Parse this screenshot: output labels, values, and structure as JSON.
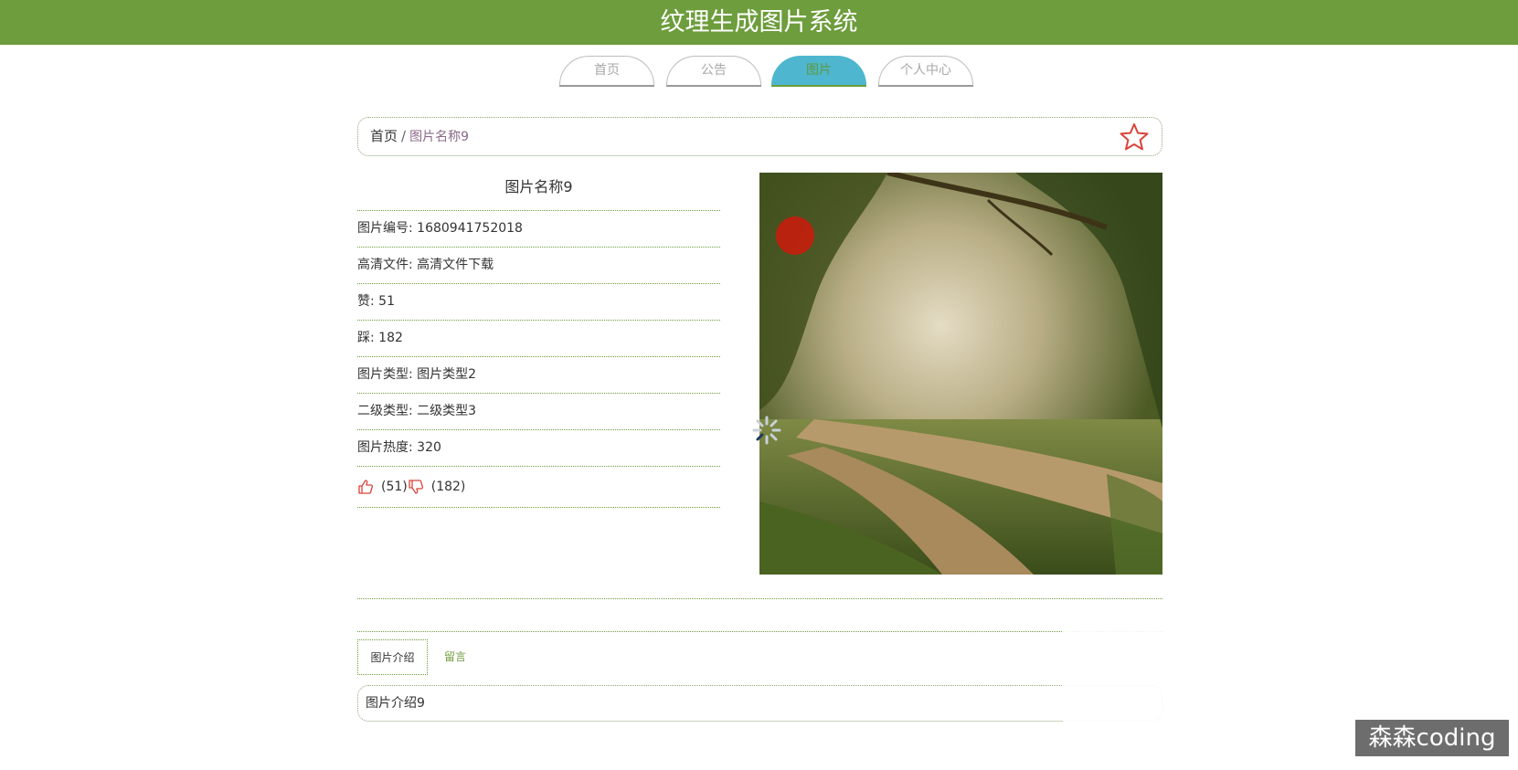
{
  "header": {
    "title": "纹理生成图片系统"
  },
  "nav": {
    "tabs": [
      "首页",
      "公告",
      "图片",
      "个人中心"
    ],
    "active": "图片"
  },
  "breadcrumb": {
    "home": "首页",
    "separator": "/",
    "current": "图片名称9"
  },
  "detail": {
    "title": "图片名称9",
    "rows": [
      {
        "label": "图片编号:",
        "value": "1680941752018"
      },
      {
        "label": "高清文件:",
        "value": "高清文件下载"
      },
      {
        "label": "赞:",
        "value": "51"
      },
      {
        "label": "踩:",
        "value": "182"
      },
      {
        "label": "图片类型:",
        "value": "图片类型2"
      },
      {
        "label": "二级类型:",
        "value": "二级类型3"
      },
      {
        "label": "图片热度:",
        "value": "320"
      }
    ],
    "like_count": "(51)",
    "dislike_count": "(182)"
  },
  "tabs": {
    "intro": "图片介绍",
    "comments": "留言"
  },
  "intro": {
    "text": "图片介绍9"
  },
  "watermark": "森森coding",
  "colors": {
    "brand": "#6d9d3c",
    "active_tab": "#4fb6cf",
    "star": "#d9443a"
  },
  "icons": {
    "favorite": "star-icon",
    "like": "thumbs-up-icon",
    "dislike": "thumbs-down-icon",
    "loading": "spinner-icon"
  }
}
